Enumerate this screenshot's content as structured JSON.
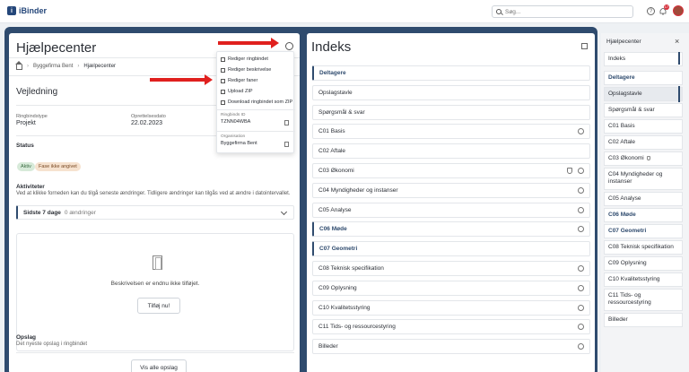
{
  "app": {
    "logo_text": "iBinder",
    "logo_letter": "i"
  },
  "topbar": {
    "search_placeholder": "Søg...",
    "help_glyph": "?",
    "notification_count": "17"
  },
  "left": {
    "title": "Hjælpecenter",
    "breadcrumb": [
      "Byggefirma Bent",
      "Hjælpecenter"
    ],
    "guide_heading": "Vejledning",
    "fields": [
      {
        "label": "Ringbindstype",
        "value": "Projekt"
      },
      {
        "label": "Oprettelsesdato",
        "value": "22.02.2023"
      }
    ],
    "status_heading": "Status",
    "badges": [
      "Aktiv",
      "Fase ikke angivet"
    ],
    "activities_heading": "Aktiviteter",
    "activities_text": "Ved at klikke forneden kan du tilgå seneste ændringer. Tidligere ændringer kan tilgås ved at ændre i datointervallet.",
    "accordion": {
      "period": "Sidste 7 dage",
      "changes": "0 ændringer"
    },
    "empty_text": "Beskrivelsen er endnu ikke tilføjet.",
    "add_button": "Tilføj nu!",
    "opslag_heading": "Opslag",
    "opslag_text": "Det nyeste opslag i ringbindet",
    "view_all_button": "Vis alle opslag"
  },
  "menu": {
    "items": [
      "Rediger ringbindet",
      "Rediger beskrivelse",
      "Rediger faner",
      "Upload ZIP",
      "Download ringbindet som ZIP"
    ],
    "id_label": "Ringbinds ID",
    "id_value": "TZNN04WBA",
    "org_label": "Organisation",
    "org_value": "Byggefirma Bent"
  },
  "index": {
    "title": "Indeks",
    "rows": [
      {
        "label": "Deltagere",
        "bold": true,
        "icon": "none"
      },
      {
        "label": "Opslagstavle",
        "bold": false,
        "icon": "none"
      },
      {
        "label": "Spørgsmål & svar",
        "bold": false,
        "icon": "none"
      },
      {
        "label": "C01 Basis",
        "bold": false,
        "icon": "circle"
      },
      {
        "label": "C02 Aftale",
        "bold": false,
        "icon": "none"
      },
      {
        "label": "C03 Økonomi",
        "bold": false,
        "icon": "shield-circle"
      },
      {
        "label": "C04 Myndigheder og instanser",
        "bold": false,
        "icon": "circle"
      },
      {
        "label": "C05 Analyse",
        "bold": false,
        "icon": "circle"
      },
      {
        "label": "C06 Møde",
        "bold": true,
        "icon": "circle"
      },
      {
        "label": "C07 Geometri",
        "bold": true,
        "icon": "none"
      },
      {
        "label": "C08 Teknisk specifikation",
        "bold": false,
        "icon": "circle"
      },
      {
        "label": "C09 Oplysning",
        "bold": false,
        "icon": "circle"
      },
      {
        "label": "C10 Kvalitetsstyring",
        "bold": false,
        "icon": "circle"
      },
      {
        "label": "C11 Tids- og ressourcestyring",
        "bold": false,
        "icon": "circle"
      },
      {
        "label": "Billeder",
        "bold": false,
        "icon": "circle"
      }
    ]
  },
  "side": {
    "header": "Hjælpecenter",
    "close": "×",
    "items": [
      {
        "label": "Indeks",
        "bold": false
      },
      {
        "label": "Deltagere",
        "bold": true
      },
      {
        "label": "Opslagstavle",
        "bold": false
      },
      {
        "label": "Spørgsmål & svar",
        "bold": false
      },
      {
        "label": "C01 Basis",
        "bold": false
      },
      {
        "label": "C02 Aftale",
        "bold": false
      },
      {
        "label": "C03 Økonomi",
        "bold": false
      },
      {
        "label": "C04 Myndigheder og instanser",
        "bold": false
      },
      {
        "label": "C05 Analyse",
        "bold": false
      },
      {
        "label": "C06 Møde",
        "bold": true
      },
      {
        "label": "C07 Geometri",
        "bold": true
      },
      {
        "label": "C08 Teknisk specifikation",
        "bold": false
      },
      {
        "label": "C09 Oplysning",
        "bold": false
      },
      {
        "label": "C10 Kvalitetsstyring",
        "bold": false
      },
      {
        "label": "C11 Tids- og ressourcestyring",
        "bold": false
      },
      {
        "label": "Billeder",
        "bold": false
      }
    ]
  },
  "colors": {
    "frame": "#2f4b6e",
    "arrow": "#e0201e",
    "accent": "#2f4b6e"
  }
}
